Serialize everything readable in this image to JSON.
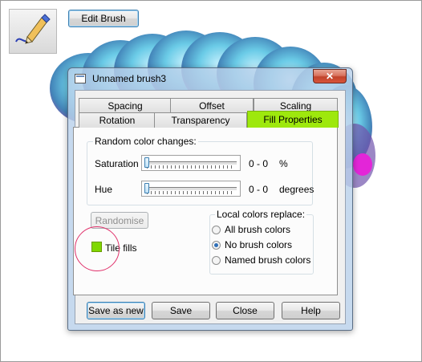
{
  "app": {
    "icon": "pen-drawing-icon",
    "edit_brush_label": "Edit Brush"
  },
  "dialog": {
    "title": "Unnamed brush3",
    "close_glyph": "✕",
    "tabs_back": [
      "Spacing",
      "Offset",
      "Scaling"
    ],
    "tabs_front": [
      "Rotation",
      "Transparency",
      "Fill Properties"
    ],
    "active_tab": "Fill Properties",
    "active_tab_color": "#9ee80d",
    "random_group_label": "Random color changes:",
    "saturation": {
      "label": "Saturation",
      "value": "0 - 0",
      "unit": "%",
      "level": 0
    },
    "hue": {
      "label": "Hue",
      "value": "0 - 0",
      "unit": "degrees",
      "level": 0
    },
    "randomise_label": "Randomise",
    "tile_fills_label": "Tile fills",
    "tile_fills_checked": true,
    "local_group_label": "Local colors replace:",
    "radio_options": [
      {
        "label": "All brush colors",
        "selected": false
      },
      {
        "label": "No brush colors",
        "selected": true
      },
      {
        "label": "Named brush colors",
        "selected": false
      }
    ],
    "buttons": {
      "save_as_new": "Save as new",
      "save": "Save",
      "close": "Close",
      "help": "Help"
    }
  }
}
